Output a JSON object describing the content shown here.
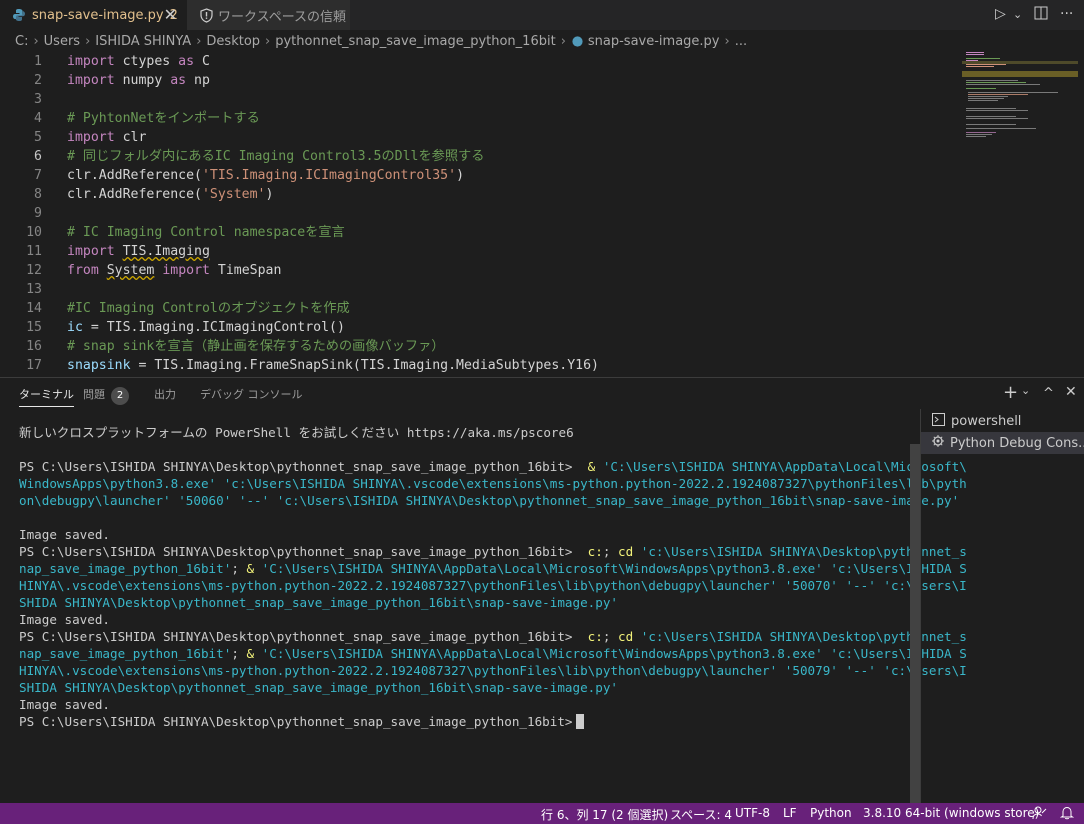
{
  "tabs": {
    "active": {
      "label": "snap-save-image.py",
      "badge": "2"
    },
    "trust": {
      "label": "ワークスペースの信頼"
    }
  },
  "breadcrumb": [
    "C:",
    "Users",
    "ISHIDA SHINYA",
    "Desktop",
    "pythonnet_snap_save_image_python_16bit",
    "snap-save-image.py",
    "..."
  ],
  "editor": {
    "current_line": 6,
    "lines": [
      {
        "n": "1",
        "parts": [
          [
            "kw",
            "import"
          ],
          [
            "id",
            " ctypes "
          ],
          [
            "kw",
            "as"
          ],
          [
            "id",
            " C"
          ]
        ]
      },
      {
        "n": "2",
        "parts": [
          [
            "kw",
            "import"
          ],
          [
            "id",
            " numpy "
          ],
          [
            "kw",
            "as"
          ],
          [
            "id",
            " np"
          ]
        ]
      },
      {
        "n": "3",
        "parts": []
      },
      {
        "n": "4",
        "parts": [
          [
            "cm",
            "# PyhtonNetをインポートする"
          ]
        ]
      },
      {
        "n": "5",
        "parts": [
          [
            "kw",
            "import"
          ],
          [
            "id",
            " clr"
          ]
        ]
      },
      {
        "n": "6",
        "parts": [
          [
            "cm",
            "# 同じフォルダ内にあるIC Imaging Control3.5のDllを参照する"
          ]
        ]
      },
      {
        "n": "7",
        "parts": [
          [
            "id",
            "clr.AddReference("
          ],
          [
            "st",
            "'TIS.Imaging.ICImagingControl35'"
          ],
          [
            "id",
            ")"
          ]
        ]
      },
      {
        "n": "8",
        "parts": [
          [
            "id",
            "clr.AddReference("
          ],
          [
            "st",
            "'System'"
          ],
          [
            "id",
            ")"
          ]
        ]
      },
      {
        "n": "9",
        "parts": []
      },
      {
        "n": "10",
        "parts": [
          [
            "cm",
            "# IC Imaging Control namespaceを宣言"
          ]
        ]
      },
      {
        "n": "11",
        "parts": [
          [
            "kw",
            "import"
          ],
          [
            "id",
            " "
          ],
          [
            "sq",
            "TIS.Imaging"
          ]
        ]
      },
      {
        "n": "12",
        "parts": [
          [
            "kw",
            "from"
          ],
          [
            "id",
            " "
          ],
          [
            "sq",
            "System"
          ],
          [
            "id",
            " "
          ],
          [
            "kw",
            "import"
          ],
          [
            "id",
            " TimeSpan"
          ]
        ]
      },
      {
        "n": "13",
        "parts": []
      },
      {
        "n": "14",
        "parts": [
          [
            "cm",
            "#IC Imaging Controlのオブジェクトを作成"
          ]
        ]
      },
      {
        "n": "15",
        "parts": [
          [
            "vr",
            "ic"
          ],
          [
            "id",
            " = TIS.Imaging.ICImagingControl()"
          ]
        ]
      },
      {
        "n": "16",
        "parts": [
          [
            "cm",
            "# snap sinkを宣言（静止画を保存するための画像バッファ）"
          ]
        ]
      },
      {
        "n": "17",
        "parts": [
          [
            "vr",
            "snapsink"
          ],
          [
            "id",
            " = TIS.Imaging.FrameSnapSink(TIS.Imaging.MediaSubtypes.Y16)"
          ]
        ]
      }
    ]
  },
  "panel": {
    "tabs": [
      "ターミナル",
      "問題",
      "出力",
      "デバッグ コンソール"
    ],
    "problems_count": "2",
    "actions": {
      "add": "+",
      "chevron": "⌄",
      "maximize": "^",
      "close": "✕"
    }
  },
  "terminal": {
    "lines": [
      [
        [
          "t",
          "新しいクロスプラットフォームの PowerShell をお試しください https://aka.ms/pscore6"
        ]
      ],
      [],
      [
        [
          "t",
          "PS C:\\Users\\ISHIDA SHINYA\\Desktop\\pythonnet_snap_save_image_python_16bit>  "
        ],
        [
          "c",
          "&"
        ],
        [
          "t",
          " "
        ],
        [
          "s",
          "'C:\\Users\\ISHIDA SHINYA\\AppData\\Local\\Microsoft\\"
        ]
      ],
      [
        [
          "s",
          "WindowsApps\\python3.8.exe' 'c:\\Users\\ISHIDA SHINYA\\.vscode\\extensions\\ms-python.python-2022.2.1924087327\\pythonFiles\\lib\\pyth"
        ]
      ],
      [
        [
          "s",
          "on\\debugpy\\launcher' '50060' '--' 'c:\\Users\\ISHIDA SHINYA\\Desktop\\pythonnet_snap_save_image_python_16bit\\snap-save-image.py'"
        ]
      ],
      [],
      [
        [
          "t",
          "Image saved."
        ]
      ],
      [
        [
          "t",
          "PS C:\\Users\\ISHIDA SHINYA\\Desktop\\pythonnet_snap_save_image_python_16bit>  "
        ],
        [
          "c",
          "c:"
        ],
        [
          "t",
          "; "
        ],
        [
          "c",
          "cd"
        ],
        [
          "t",
          " "
        ],
        [
          "s",
          "'c:\\Users\\ISHIDA SHINYA\\Desktop\\pythonnet_s"
        ]
      ],
      [
        [
          "s",
          "nap_save_image_python_16bit'"
        ],
        [
          "t",
          "; "
        ],
        [
          "c",
          "&"
        ],
        [
          "t",
          " "
        ],
        [
          "s",
          "'C:\\Users\\ISHIDA SHINYA\\AppData\\Local\\Microsoft\\WindowsApps\\python3.8.exe' 'c:\\Users\\ISHIDA S"
        ]
      ],
      [
        [
          "s",
          "HINYA\\.vscode\\extensions\\ms-python.python-2022.2.1924087327\\pythonFiles\\lib\\python\\debugpy\\launcher' '50070' '--' 'c:\\Users\\I"
        ]
      ],
      [
        [
          "s",
          "SHIDA SHINYA\\Desktop\\pythonnet_snap_save_image_python_16bit\\snap-save-image.py'"
        ]
      ],
      [
        [
          "t",
          "Image saved."
        ]
      ],
      [
        [
          "t",
          "PS C:\\Users\\ISHIDA SHINYA\\Desktop\\pythonnet_snap_save_image_python_16bit>  "
        ],
        [
          "c",
          "c:"
        ],
        [
          "t",
          "; "
        ],
        [
          "c",
          "cd"
        ],
        [
          "t",
          " "
        ],
        [
          "s",
          "'c:\\Users\\ISHIDA SHINYA\\Desktop\\pythonnet_s"
        ]
      ],
      [
        [
          "s",
          "nap_save_image_python_16bit'"
        ],
        [
          "t",
          "; "
        ],
        [
          "c",
          "&"
        ],
        [
          "t",
          " "
        ],
        [
          "s",
          "'C:\\Users\\ISHIDA SHINYA\\AppData\\Local\\Microsoft\\WindowsApps\\python3.8.exe' 'c:\\Users\\ISHIDA S"
        ]
      ],
      [
        [
          "s",
          "HINYA\\.vscode\\extensions\\ms-python.python-2022.2.1924087327\\pythonFiles\\lib\\python\\debugpy\\launcher' '50079' '--' 'c:\\Users\\I"
        ]
      ],
      [
        [
          "s",
          "SHIDA SHINYA\\Desktop\\pythonnet_snap_save_image_python_16bit\\snap-save-image.py'"
        ]
      ],
      [
        [
          "t",
          "Image saved."
        ]
      ],
      [
        [
          "t",
          "PS C:\\Users\\ISHIDA SHINYA\\Desktop\\pythonnet_snap_save_image_python_16bit>"
        ]
      ]
    ]
  },
  "terminal_list": [
    {
      "label": "powershell",
      "icon": "terminal-icon",
      "selected": false
    },
    {
      "label": "Python Debug Cons...",
      "icon": "debug-gear-icon",
      "selected": true
    }
  ],
  "statusbar": {
    "position": "行 6、列 17 (2 個選択)",
    "spaces": "スペース: 4",
    "encoding": "UTF-8",
    "eol": "LF",
    "language": "Python",
    "interpreter": "3.8.10 64-bit (windows store)"
  },
  "colors": {
    "statusbar": "#68217a",
    "accent_tab_text": "#e2c08d"
  }
}
